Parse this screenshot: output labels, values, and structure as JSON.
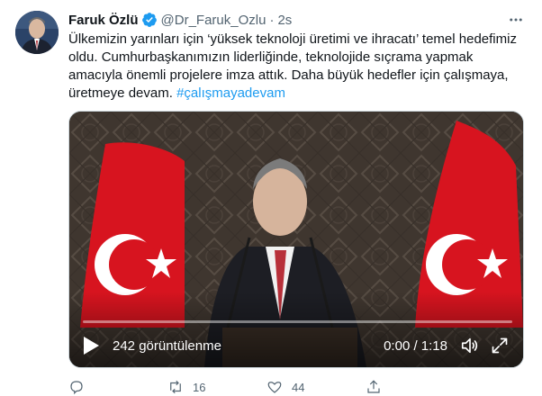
{
  "author": {
    "name": "Faruk Özlü",
    "handle": "@Dr_Faruk_Ozlu",
    "separator": "·",
    "time": "2s"
  },
  "tweet": {
    "lines": [
      "Ülkemizin yarınları için ‘yüksek teknoloji üretimi ve ihracatı’ temel hedefimiz",
      "oldu. Cumhurbaşkanımızın liderliğinde, teknolojide sıçrama yapmak",
      "amacıyla önemli projelere imza attık. Daha büyük hedefler için çalışmaya,"
    ],
    "last_line_text": "üretmeye devam. ",
    "hashtag": "#çalışmayadevam"
  },
  "video": {
    "views": "242 görüntülenme",
    "timecode": "0:00 / 1:18",
    "progress": 0
  },
  "actions": {
    "replies": "",
    "retweets": "16",
    "likes": "44"
  },
  "colors": {
    "accent": "#1d9bf0",
    "text": "#0f1419",
    "muted": "#536471",
    "flag_red": "#e30a17"
  }
}
